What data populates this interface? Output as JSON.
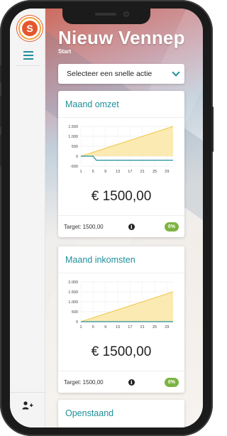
{
  "app": {
    "title": "Nieuw Vennep",
    "breadcrumb": "Start",
    "logo_letter": "S"
  },
  "quick_action": {
    "label": "Selecteer een snelle actie",
    "icon": "chevron-down-icon"
  },
  "sidebar": {
    "menu_icon": "hamburger-icon",
    "add_user_icon": "add-user-icon"
  },
  "colors": {
    "accent": "#1f8f9a",
    "chart_fill": "#fbe6a6",
    "chart_line": "#f0c84a",
    "badge": "#7cb342",
    "logo": "#e4572e"
  },
  "cards": [
    {
      "title": "Maand omzet",
      "value": "€ 1500,00",
      "target": "Target: 1500,00",
      "badge": "0%"
    },
    {
      "title": "Maand inkomsten",
      "value": "€ 1500,00",
      "target": "Target: 1500,00",
      "badge": "0%"
    },
    {
      "title": "Openstaand"
    }
  ],
  "chart_data": [
    {
      "type": "area",
      "x": [
        1,
        5,
        9,
        13,
        17,
        21,
        25,
        29
      ],
      "ytick_labels": [
        "1.500",
        "1.000",
        "500",
        "0",
        "-500"
      ],
      "ylim": [
        -500,
        1500
      ],
      "xlim": [
        1,
        31
      ],
      "series": [
        {
          "name": "",
          "x": [
            1,
            31
          ],
          "y": [
            0,
            1500
          ],
          "style": "area"
        },
        {
          "name": "",
          "x": [
            1,
            5,
            6,
            31
          ],
          "y": [
            0,
            0,
            -200,
            -200
          ],
          "style": "line"
        }
      ],
      "grid": true
    },
    {
      "type": "area",
      "x": [
        1,
        5,
        9,
        13,
        17,
        21,
        25,
        29
      ],
      "ytick_labels": [
        "2.000",
        "1.500",
        "1.000",
        "500",
        "0"
      ],
      "ylim": [
        0,
        2000
      ],
      "xlim": [
        1,
        31
      ],
      "series": [
        {
          "name": "",
          "x": [
            1,
            31
          ],
          "y": [
            0,
            1500
          ],
          "style": "area"
        },
        {
          "name": "",
          "x": [
            1,
            31
          ],
          "y": [
            0,
            0
          ],
          "style": "line"
        }
      ],
      "grid": true
    }
  ]
}
